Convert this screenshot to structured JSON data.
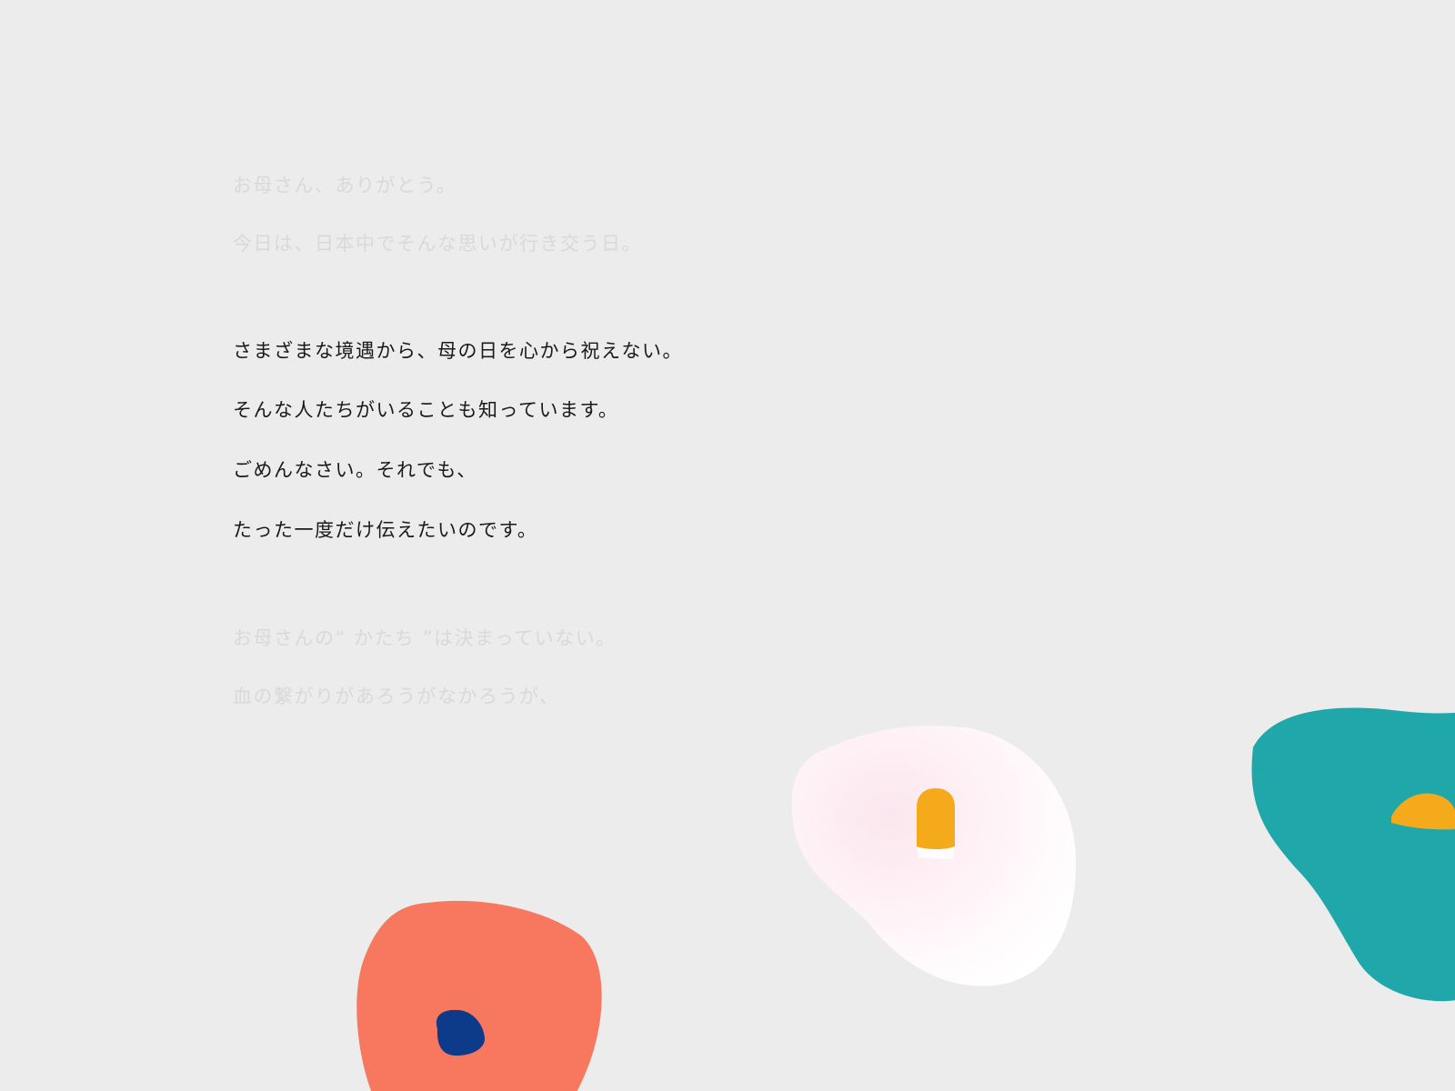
{
  "message": {
    "lines": [
      {
        "text": " お母さん、ありがとう。",
        "state": "faded"
      },
      {
        "text": "今日は、日本中でそんな思いが行き交う日。",
        "state": "faded"
      },
      {
        "text": "さまざまな境遇から、母の日を心から祝えない。",
        "state": "active"
      },
      {
        "text": "そんな人たちがいることも知っています。",
        "state": "active"
      },
      {
        "text": "ごめんなさい。それでも、",
        "state": "active"
      },
      {
        "text": "たった一度だけ伝えたいのです。",
        "state": "active"
      },
      {
        "text": "お母さんの“ かたち ”は決まっていない。",
        "state": "faded"
      },
      {
        "text": " 血の繋がりがあろうがなかろうが、",
        "state": "faded"
      }
    ]
  },
  "colors": {
    "background": "#ececec",
    "text_active": "#1a1a1a",
    "text_faded": "#d9d9d9",
    "flower_coral": "#f7775f",
    "flower_coral_center": "#0e3a8a",
    "flower_white": "#fdf0f4",
    "flower_white_center": "#f5aa1c",
    "flower_teal": "#1fa7aa",
    "flower_teal_center": "#f5aa1c"
  },
  "decorations": [
    {
      "name": "coral-flower-icon",
      "color": "coral"
    },
    {
      "name": "white-flower-icon",
      "color": "white"
    },
    {
      "name": "teal-flower-icon",
      "color": "teal"
    }
  ]
}
